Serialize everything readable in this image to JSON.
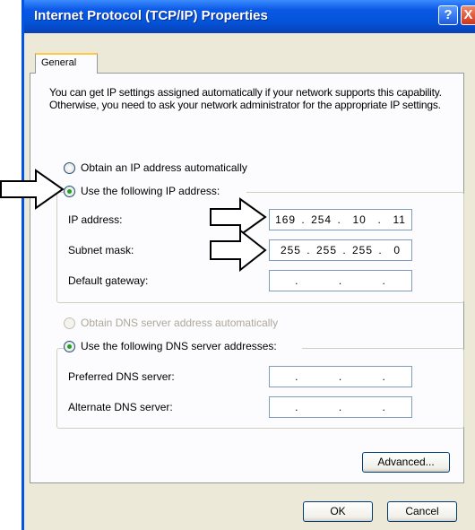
{
  "window": {
    "title": "Internet Protocol (TCP/IP) Properties",
    "help_icon_glyph": "?",
    "close_icon_glyph": "X"
  },
  "tabs": [
    {
      "label": "General",
      "selected": true
    }
  ],
  "intro_text": "You can get IP settings assigned automatically if your network supports this capability. Otherwise, you need to ask your network administrator for the appropriate IP settings.",
  "ip_section": {
    "auto_label": "Obtain an IP address automatically",
    "auto_selected": false,
    "manual_label": "Use the following IP address:",
    "manual_selected": true,
    "fields": [
      {
        "label": "IP address:",
        "value": "169 . 254 .  10  .  11"
      },
      {
        "label": "Subnet mask:",
        "value": "255 . 255 . 255 .  0"
      },
      {
        "label": "Default gateway:",
        "value": ".       .       ."
      }
    ]
  },
  "dns_section": {
    "auto_label": "Obtain DNS server address automatically",
    "auto_enabled": false,
    "manual_label": "Use the following DNS server addresses:",
    "manual_selected": true,
    "fields": [
      {
        "label": "Preferred DNS server:",
        "value": ".       .       ."
      },
      {
        "label": "Alternate DNS server:",
        "value": ".       .       ."
      }
    ]
  },
  "buttons": {
    "advanced": "Advanced...",
    "ok": "OK",
    "cancel": "Cancel"
  },
  "colors": {
    "titlebar": "#0453d6",
    "dialog_bg": "#ece9d8",
    "radio_dot": "#21a121",
    "disabled_text": "#aca899"
  }
}
